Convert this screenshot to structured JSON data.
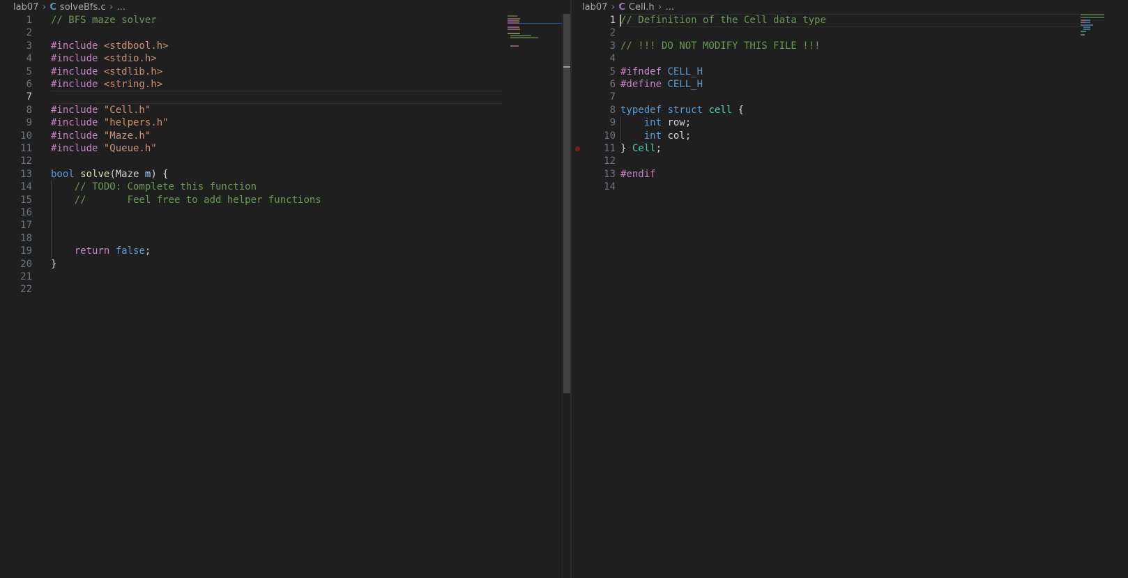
{
  "left": {
    "breadcrumb": {
      "folder": "lab07",
      "icon": "C",
      "file": "solveBfs.c",
      "more": "..."
    },
    "active_line": 7,
    "lines": [
      {
        "n": "1",
        "tokens": [
          {
            "t": "// BFS maze solver",
            "c": "comment"
          }
        ]
      },
      {
        "n": "2",
        "tokens": []
      },
      {
        "n": "3",
        "tokens": [
          {
            "t": "#include ",
            "c": "directive"
          },
          {
            "t": "<stdbool.h>",
            "c": "string"
          }
        ]
      },
      {
        "n": "4",
        "tokens": [
          {
            "t": "#include ",
            "c": "directive"
          },
          {
            "t": "<stdio.h>",
            "c": "string"
          }
        ]
      },
      {
        "n": "5",
        "tokens": [
          {
            "t": "#include ",
            "c": "directive"
          },
          {
            "t": "<stdlib.h>",
            "c": "string"
          }
        ]
      },
      {
        "n": "6",
        "tokens": [
          {
            "t": "#include ",
            "c": "directive"
          },
          {
            "t": "<string.h>",
            "c": "string"
          }
        ]
      },
      {
        "n": "7",
        "tokens": []
      },
      {
        "n": "8",
        "tokens": [
          {
            "t": "#include ",
            "c": "directive"
          },
          {
            "t": "\"Cell.h\"",
            "c": "string"
          }
        ]
      },
      {
        "n": "9",
        "tokens": [
          {
            "t": "#include ",
            "c": "directive"
          },
          {
            "t": "\"helpers.h\"",
            "c": "string"
          }
        ]
      },
      {
        "n": "10",
        "tokens": [
          {
            "t": "#include ",
            "c": "directive"
          },
          {
            "t": "\"Maze.h\"",
            "c": "string"
          }
        ]
      },
      {
        "n": "11",
        "tokens": [
          {
            "t": "#include ",
            "c": "directive"
          },
          {
            "t": "\"Queue.h\"",
            "c": "string"
          }
        ]
      },
      {
        "n": "12",
        "tokens": []
      },
      {
        "n": "13",
        "tokens": [
          {
            "t": "bool",
            "c": "keyword"
          },
          {
            "t": " "
          },
          {
            "t": "solve",
            "c": "func"
          },
          {
            "t": "(Maze "
          },
          {
            "t": "m",
            "c": "param"
          },
          {
            "t": ") {"
          }
        ]
      },
      {
        "n": "14",
        "tokens": [
          {
            "t": "    "
          },
          {
            "t": "// TODO: Complete this function",
            "c": "comment"
          }
        ]
      },
      {
        "n": "15",
        "tokens": [
          {
            "t": "    "
          },
          {
            "t": "//       Feel free to add helper functions",
            "c": "comment"
          }
        ]
      },
      {
        "n": "16",
        "tokens": []
      },
      {
        "n": "17",
        "tokens": []
      },
      {
        "n": "18",
        "tokens": []
      },
      {
        "n": "19",
        "tokens": [
          {
            "t": "    "
          },
          {
            "t": "return",
            "c": "control"
          },
          {
            "t": " "
          },
          {
            "t": "false",
            "c": "keyword"
          },
          {
            "t": ";"
          }
        ]
      },
      {
        "n": "20",
        "tokens": [
          {
            "t": "}"
          }
        ]
      },
      {
        "n": "21",
        "tokens": []
      },
      {
        "n": "22",
        "tokens": []
      }
    ]
  },
  "right": {
    "breadcrumb": {
      "folder": "lab07",
      "icon": "C",
      "file": "Cell.h",
      "more": "..."
    },
    "active_line": 1,
    "breakpoint_line": 11,
    "lines": [
      {
        "n": "1",
        "tokens": [
          {
            "t": "// Definition of the Cell data type",
            "c": "comment"
          }
        ]
      },
      {
        "n": "2",
        "tokens": []
      },
      {
        "n": "3",
        "tokens": [
          {
            "t": "// !!! DO NOT MODIFY THIS FILE !!!",
            "c": "comment"
          }
        ]
      },
      {
        "n": "4",
        "tokens": []
      },
      {
        "n": "5",
        "tokens": [
          {
            "t": "#ifndef ",
            "c": "directive"
          },
          {
            "t": "CELL_H",
            "c": "macro"
          }
        ]
      },
      {
        "n": "6",
        "tokens": [
          {
            "t": "#define ",
            "c": "directive"
          },
          {
            "t": "CELL_H",
            "c": "macro"
          }
        ]
      },
      {
        "n": "7",
        "tokens": []
      },
      {
        "n": "8",
        "tokens": [
          {
            "t": "typedef",
            "c": "keyword"
          },
          {
            "t": " "
          },
          {
            "t": "struct",
            "c": "keyword"
          },
          {
            "t": " "
          },
          {
            "t": "cell",
            "c": "type"
          },
          {
            "t": " {"
          }
        ]
      },
      {
        "n": "9",
        "tokens": [
          {
            "t": "    "
          },
          {
            "t": "int",
            "c": "keyword"
          },
          {
            "t": " row;"
          }
        ]
      },
      {
        "n": "10",
        "tokens": [
          {
            "t": "    "
          },
          {
            "t": "int",
            "c": "keyword"
          },
          {
            "t": " col;"
          }
        ]
      },
      {
        "n": "11",
        "tokens": [
          {
            "t": "} "
          },
          {
            "t": "Cell",
            "c": "type"
          },
          {
            "t": ";"
          }
        ]
      },
      {
        "n": "12",
        "tokens": []
      },
      {
        "n": "13",
        "tokens": [
          {
            "t": "#endif",
            "c": "directive"
          }
        ]
      },
      {
        "n": "14",
        "tokens": []
      }
    ]
  },
  "colors": {
    "background": "#1f1f1f",
    "comment": "#6a9955",
    "directive": "#c586c0",
    "string": "#ce9178",
    "keyword": "#569cd6",
    "type": "#4ec9b0",
    "func": "#dcdcaa",
    "breakpoint": "#7a1f1f"
  }
}
